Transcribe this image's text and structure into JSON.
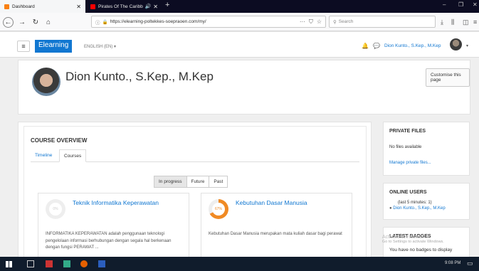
{
  "browser": {
    "tabs": [
      {
        "title": "Dashboard",
        "active": true
      },
      {
        "title": "Pirates Of The Caribbean /̇",
        "active": false
      }
    ],
    "url": "https://elearning-poltekkes-soepraoen.com/my/",
    "search_placeholder": "Search"
  },
  "moodle": {
    "brand": "Elearning",
    "language": "ENGLISH (EN) ▾",
    "user_name": "Dion Kunto., S.Kep., M.Kep"
  },
  "header": {
    "title": "Dion Kunto., S.Kep., M.Kep",
    "customise_label": "Customise this page"
  },
  "overview": {
    "title": "COURSE OVERVIEW",
    "tabs": [
      "Timeline",
      "Courses"
    ],
    "filters": [
      "In progress",
      "Future",
      "Past"
    ],
    "courses": [
      {
        "title": "Teknik Informatika Keperawatan",
        "progress_label": "0%",
        "progress": 0,
        "description": "INFORMATIKA KEPERAWATAN adalah penggunaan teknologi pengelolaan informasi berhubungan dengan segala hal berkenaan dengan fungsi PERAWAT ..."
      },
      {
        "title": "Kebutuhan Dasar Manusia",
        "progress_label": "67%",
        "progress": 67,
        "description": "Kebutuhan Dasar Manusia merupakan mata kuliah dasar bagi perawat"
      }
    ]
  },
  "blocks": {
    "private_files": {
      "title": "PRIVATE FILES",
      "empty_text": "No files available",
      "manage_link": "Manage private files..."
    },
    "online_users": {
      "title": "ONLINE USERS",
      "subtitle": "(last 5 minutes: 1)",
      "user": "Dion Kunto., S.Kep., M.Kep"
    },
    "latest_badges": {
      "title": "LATEST BADGES",
      "empty_text": "You have no badges to display"
    }
  },
  "watermark": {
    "line1": "Activate Windows",
    "line2": "Go to Settings to activate Windows."
  },
  "taskbar": {
    "time": "9:08 PM"
  },
  "colors": {
    "accent": "#1177d1",
    "progress": "#f08a24"
  }
}
